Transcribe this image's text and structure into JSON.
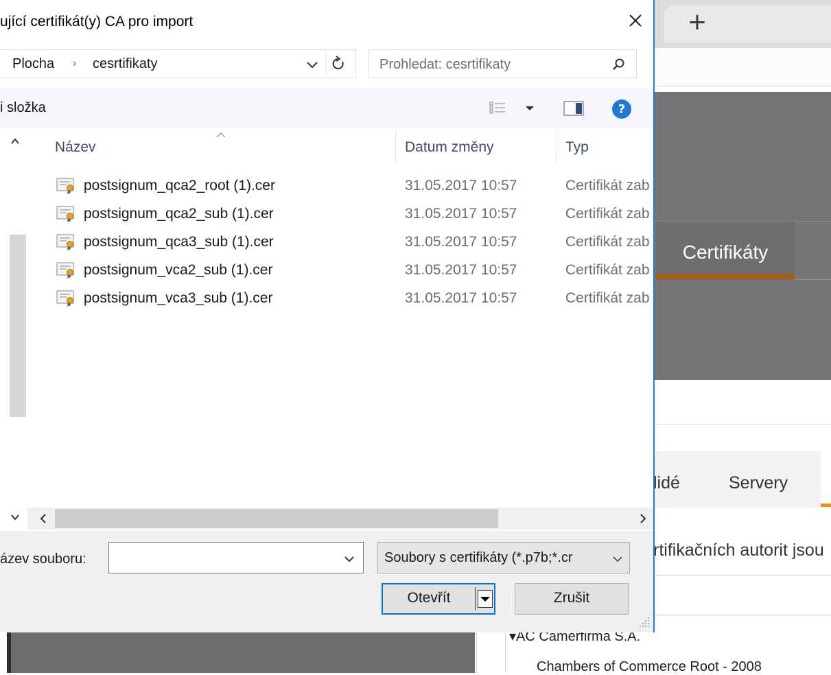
{
  "background": {
    "new_tab_symbol": "+",
    "cert_tab_label": "Certifikáty",
    "subtabs": [
      "lidé",
      "Servery"
    ],
    "description_text": "rtifikačních autorit jsou",
    "tree_group": "AC Camerfirma S.A.",
    "tree_item": "Chambers of Commerce Root - 2008"
  },
  "dialog": {
    "title": "ující certifikát(y) CA pro import",
    "address": {
      "segments": [
        "Plocha",
        "cesrtifikaty"
      ],
      "separator": "›"
    },
    "search": {
      "placeholder": "Prohledat: cesrtifikaty"
    },
    "toolbar": {
      "new_folder_label": "i složka"
    },
    "columns": {
      "name": "Název",
      "date": "Datum změny",
      "type": "Typ"
    },
    "files": [
      {
        "name": "postsignum_qca2_root (1).cer",
        "date": "31.05.2017 10:57",
        "type": "Certifikát zab"
      },
      {
        "name": "postsignum_qca2_sub (1).cer",
        "date": "31.05.2017 10:57",
        "type": "Certifikát zab"
      },
      {
        "name": "postsignum_qca3_sub (1).cer",
        "date": "31.05.2017 10:57",
        "type": "Certifikát zab"
      },
      {
        "name": "postsignum_vca2_sub (1).cer",
        "date": "31.05.2017 10:57",
        "type": "Certifikát zab"
      },
      {
        "name": "postsignum_vca3_sub (1).cer",
        "date": "31.05.2017 10:57",
        "type": "Certifikát zab"
      }
    ],
    "filename_label": "ázev souboru:",
    "filename_value": "",
    "filetype_value": "Soubory s certifikáty (*.p7b;*.cr",
    "open_button": "Otevřít",
    "cancel_button": "Zrušit"
  },
  "colors": {
    "accent_blue": "#0078d7",
    "cert_tab_underline": "#b35a00",
    "subtab_accent": "#f08c1a",
    "help_icon": "#1e78d4"
  }
}
